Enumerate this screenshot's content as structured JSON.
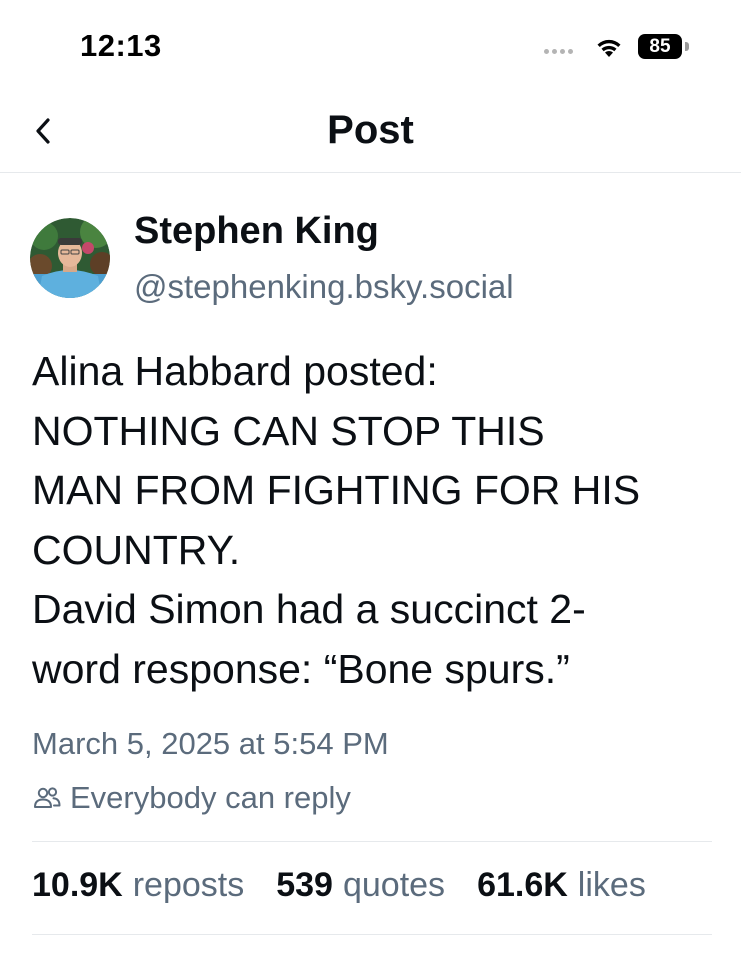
{
  "status_bar": {
    "time": "12:13",
    "battery": "85",
    "icons": [
      "cellular-signal-icon",
      "wifi-icon",
      "battery-icon"
    ]
  },
  "header": {
    "title": "Post",
    "back_icon": "chevron-left-icon"
  },
  "post": {
    "author": {
      "name": "Stephen King",
      "handle": "@stephenking.bsky.social"
    },
    "text_lines": [
      "Alina Habbard posted:",
      "NOTHING CAN STOP THIS",
      "MAN FROM FIGHTING FOR HIS",
      "COUNTRY.",
      "David Simon had a succinct 2-",
      "word response: “Bone spurs.”"
    ],
    "timestamp": "March 5, 2025 at 5:54 PM",
    "reply_setting": "Everybody can reply",
    "stats": {
      "reposts": {
        "count": "10.9K",
        "label": "reposts"
      },
      "quotes": {
        "count": "539",
        "label": "quotes"
      },
      "likes": {
        "count": "61.6K",
        "label": "likes"
      }
    }
  },
  "colors": {
    "text_primary": "#0b0f14",
    "text_secondary": "#5b6b7c",
    "divider": "#e6e9ec"
  }
}
